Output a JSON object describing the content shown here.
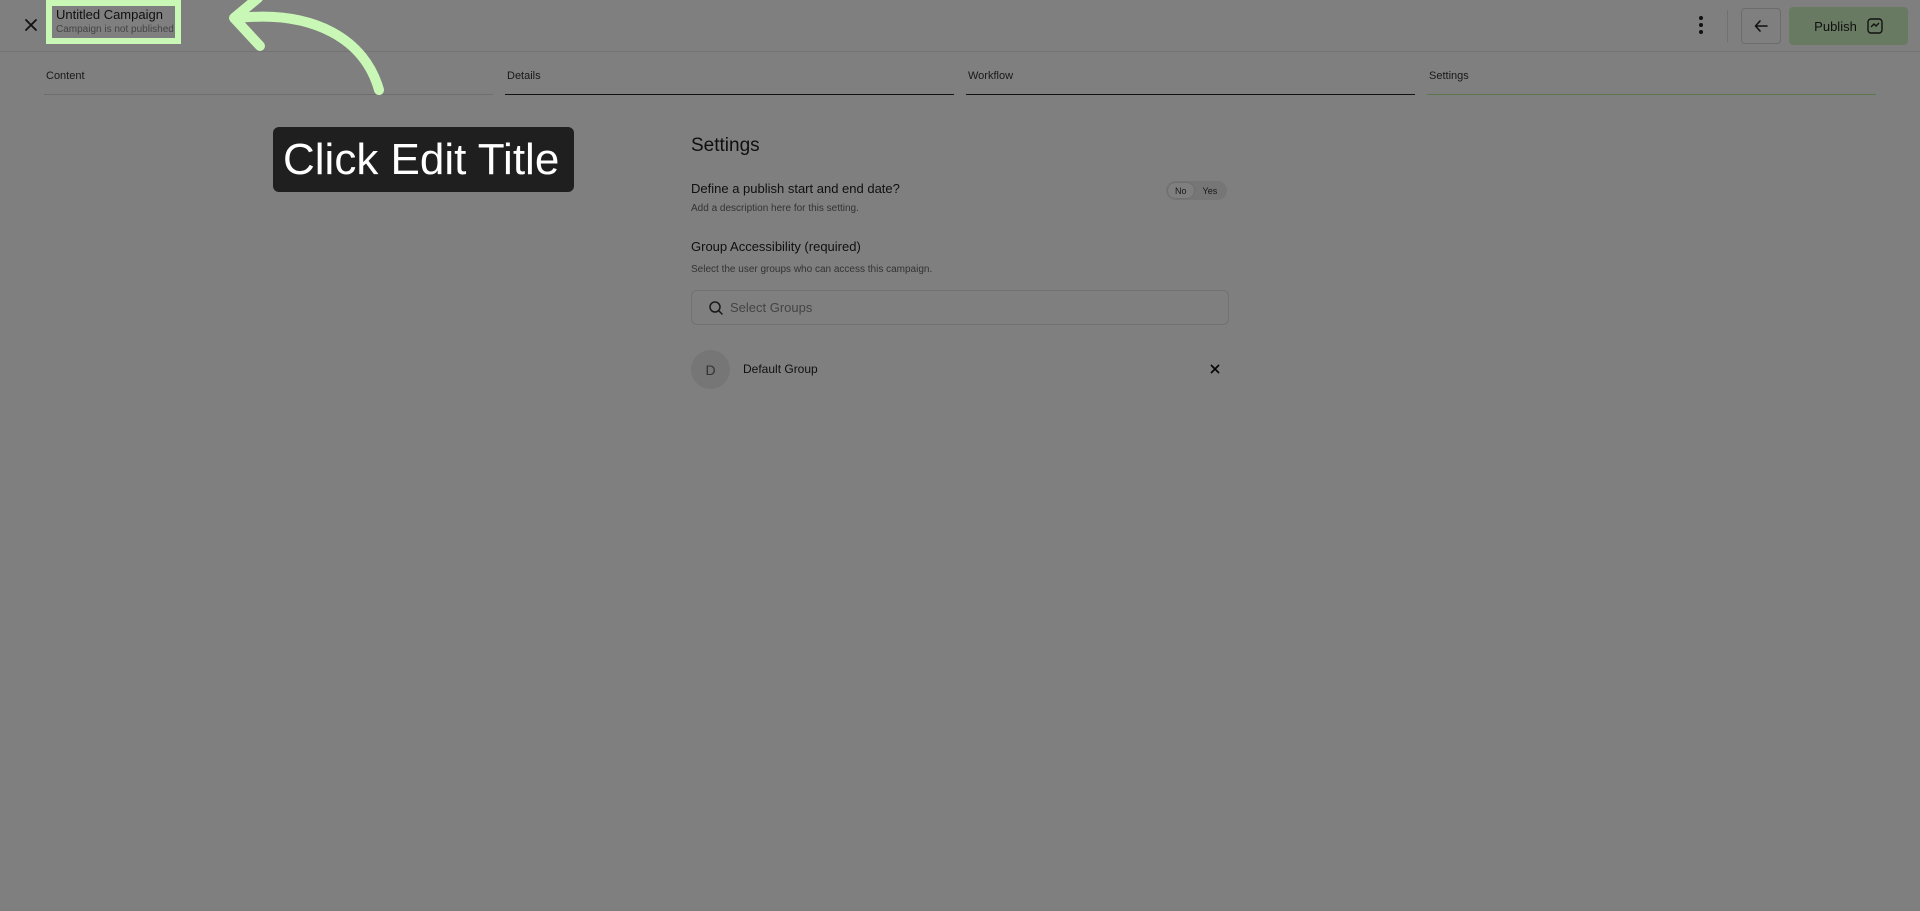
{
  "header": {
    "campaign_title": "Untitled Campaign",
    "campaign_subtitle": "Campaign is not published",
    "publish_label": "Publish"
  },
  "tabs": [
    {
      "label": "Content"
    },
    {
      "label": "Details"
    },
    {
      "label": "Workflow"
    },
    {
      "label": "Settings"
    }
  ],
  "settings": {
    "heading": "Settings",
    "publish_dates": {
      "question": "Define a publish start and end date?",
      "description": "Add a description here for this setting.",
      "toggle_no": "No",
      "toggle_yes": "Yes",
      "selected": "No"
    },
    "group_access": {
      "label": "Group Accessibility (required)",
      "description": "Select the user groups who can access this campaign.",
      "search_placeholder": "Select Groups",
      "groups": [
        {
          "initial": "D",
          "name": "Default Group"
        }
      ]
    }
  },
  "tutorial": {
    "callout_text": "Click Edit Title"
  },
  "colors": {
    "accent_highlight": "#c9f8b6",
    "publish_button": "#d2f5c4",
    "active_tab_underline": "#b6ec9a",
    "callout_background": "#1f1f1f"
  }
}
